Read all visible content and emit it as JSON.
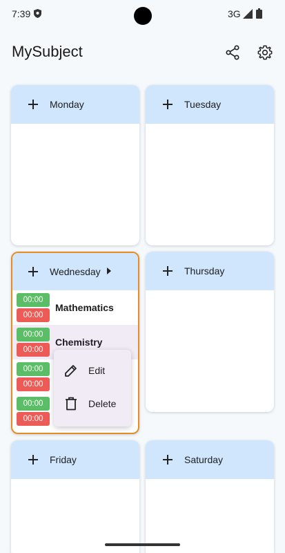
{
  "status_bar": {
    "time": "7:39",
    "network": "3G"
  },
  "app_bar": {
    "title": "MySubject",
    "share_icon": "share-icon",
    "settings_icon": "gear-icon"
  },
  "days": {
    "monday": "Monday",
    "tuesday": "Tuesday",
    "wednesday": "Wednesday",
    "thursday": "Thursday",
    "friday": "Friday",
    "saturday": "Saturday"
  },
  "wednesday_subjects": [
    {
      "start": "00:00",
      "end": "00:00",
      "name": "Mathematics"
    },
    {
      "start": "00:00",
      "end": "00:00",
      "name": "Chemistry"
    },
    {
      "start": "00:00",
      "end": "00:00",
      "name": ""
    },
    {
      "start": "00:00",
      "end": "00:00",
      "name": ""
    }
  ],
  "context_menu": {
    "edit": "Edit",
    "delete": "Delete"
  },
  "colors": {
    "header": "#cfe6fd",
    "selected_border": "#e78b25",
    "start_time": "#5bbd66",
    "end_time": "#ed5b56",
    "menu_bg": "#f1ebf6"
  }
}
